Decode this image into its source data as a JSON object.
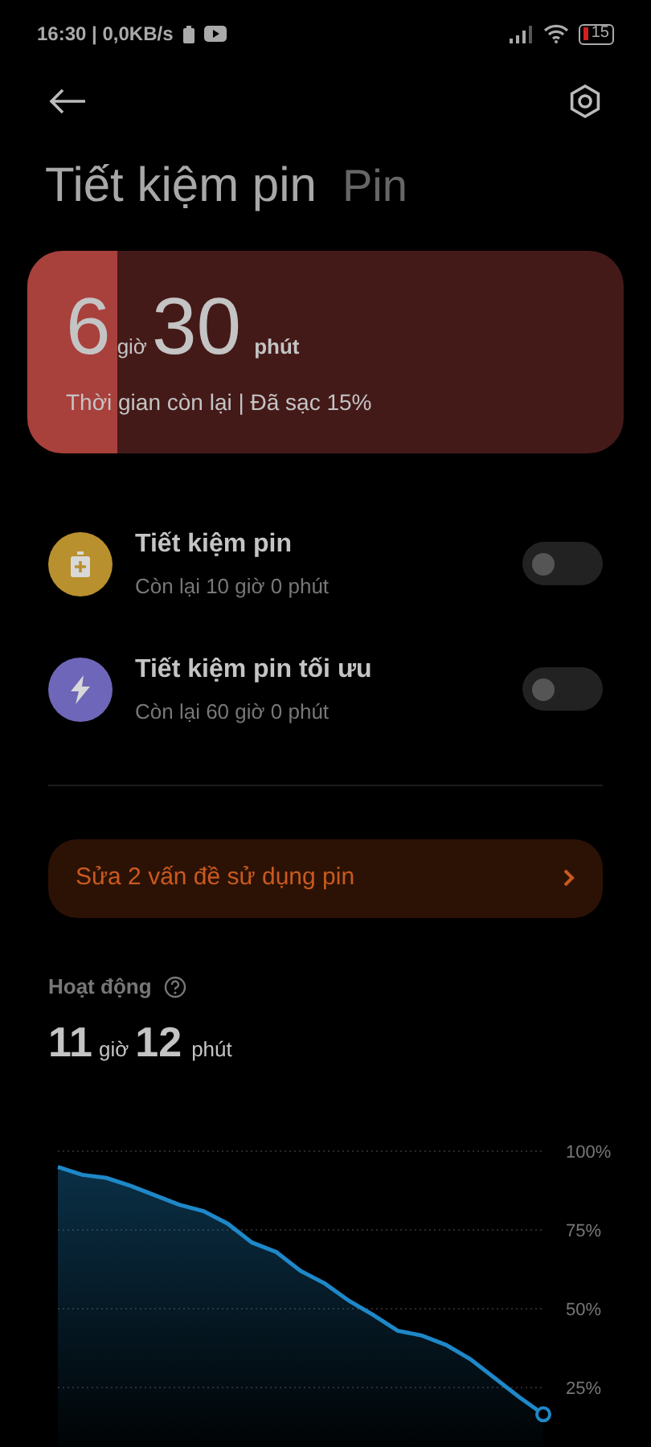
{
  "status_bar": {
    "time": "16:30 | 0,0KB/s",
    "battery": "15"
  },
  "header": {
    "title": "Tiết kiệm pin",
    "subtitle": "Pin"
  },
  "summary": {
    "hours": "6",
    "hours_unit": "giờ",
    "minutes": "30",
    "minutes_unit": "phút",
    "caption": "Thời gian còn lại | Đã sạc 15%",
    "level": 0.15
  },
  "modes": [
    {
      "kind": "battery",
      "color": "#b8902e",
      "title": "Tiết kiệm pin",
      "subtitle": "Còn lại 10 giờ 0 phút",
      "on": false
    },
    {
      "kind": "bolt",
      "color": "#6e66b8",
      "title": "Tiết kiệm pin tối ưu",
      "subtitle": "Còn lại 60 giờ 0 phút",
      "on": false
    }
  ],
  "issues_button": "Sửa 2 vấn đề sử dụng pin",
  "activity": {
    "label": "Hoạt động",
    "hours": "11",
    "hours_unit": "giờ",
    "minutes": "12",
    "minutes_unit": "phút",
    "chart_data": {
      "type": "area",
      "grid": true,
      "ylim": [
        0,
        100
      ],
      "yticks": [
        {
          "value": 100,
          "label": "100%"
        },
        {
          "value": 75,
          "label": "75%"
        },
        {
          "value": 50,
          "label": "50%"
        },
        {
          "value": 25,
          "label": "25%"
        }
      ],
      "series": [
        {
          "color": "#1e88c8",
          "values": [
            95,
            92.5,
            91.5,
            89,
            86,
            83,
            81,
            77,
            71,
            68,
            62,
            58,
            52.5,
            48,
            43,
            41.5,
            38.5,
            34,
            28,
            22,
            16.5
          ]
        }
      ]
    }
  }
}
